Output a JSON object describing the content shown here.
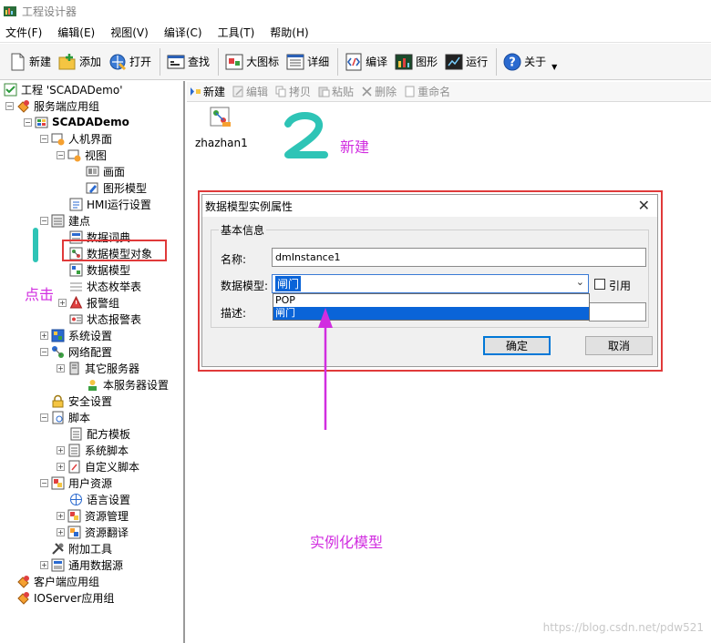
{
  "window": {
    "title": "工程设计器"
  },
  "menu": [
    "文件(F)",
    "编辑(E)",
    "视图(V)",
    "编译(C)",
    "工具(T)",
    "帮助(H)"
  ],
  "toolbar": {
    "new": "新建",
    "add": "添加",
    "open": "打开",
    "find": "查找",
    "large_icons": "大图标",
    "details": "详细",
    "compile": "编译",
    "graphics": "图形",
    "run": "运行",
    "about": "关于"
  },
  "tree": {
    "project": "工程 'SCADADemo'",
    "server_group": "服务端应用组",
    "scadademo": "SCADADemo",
    "hmi": "人机界面",
    "view": "视图",
    "screen": "画面",
    "graphic_model": "图形模型",
    "hmi_settings": "HMI运行设置",
    "build_points": "建点",
    "data_dictionary": "数据词典",
    "data_model_objects": "数据模型对象",
    "data_model": "数据模型",
    "state_enum": "状态枚举表",
    "alarm_group": "报警组",
    "state_alarm": "状态报警表",
    "system_settings": "系统设置",
    "network_config": "网络配置",
    "other_servers": "其它服务器",
    "this_server": "本服务器设置",
    "security": "安全设置",
    "script": "脚本",
    "recipe_template": "配方模板",
    "system_script": "系统脚本",
    "custom_script": "自定义脚本",
    "user_resources": "用户资源",
    "language": "语言设置",
    "resource_mgmt": "资源管理",
    "resource_translate": "资源翻译",
    "addon_tools": "附加工具",
    "common_datasource": "通用数据源",
    "client_group": "客户端应用组",
    "ioserver_group": "IOServer应用组"
  },
  "right_toolbar": {
    "new": "新建",
    "edit": "编辑",
    "copy": "拷贝",
    "paste": "粘贴",
    "delete": "删除",
    "rename": "重命名"
  },
  "instance": {
    "label": "zhazhan1"
  },
  "dialog": {
    "title": "数据模型实例属性",
    "close": "✕",
    "group": "基本信息",
    "name_label": "名称:",
    "name_value": "dmInstance1",
    "model_label": "数据模型:",
    "model_value": "闸门",
    "options": [
      "POP",
      "闸门"
    ],
    "reference_label": "引用",
    "desc_label": "描述:",
    "ok": "确定",
    "cancel": "取消"
  },
  "annotations": {
    "num_1": "1",
    "num_2": "2",
    "click": "点击",
    "new": "新建",
    "instantiate": "实例化模型"
  },
  "watermark": "https://blog.csdn.net/pdw521"
}
